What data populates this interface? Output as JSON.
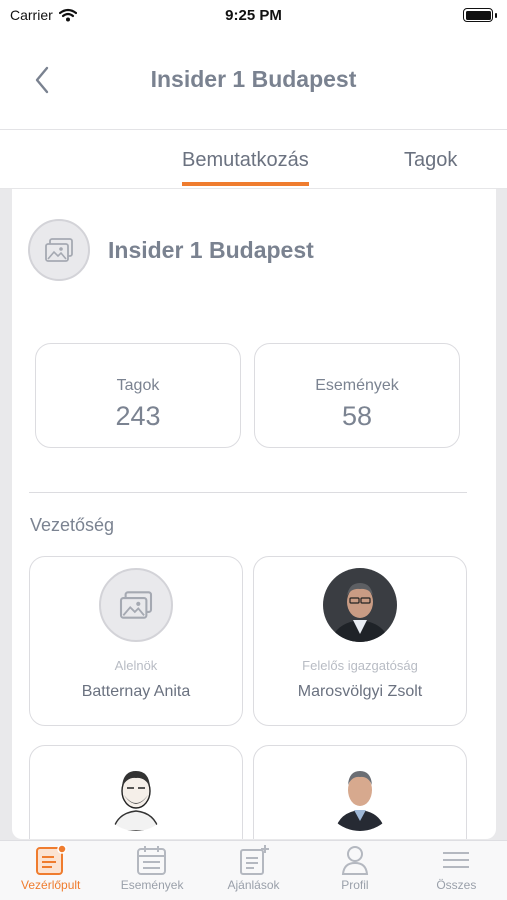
{
  "status_bar": {
    "carrier": "Carrier",
    "time": "9:25 PM"
  },
  "nav": {
    "title": "Insider 1 Budapest"
  },
  "tabs": [
    {
      "label": "Bemutatkozás",
      "active": true
    },
    {
      "label": "Tagok",
      "active": false
    }
  ],
  "group": {
    "name": "Insider 1 Budapest"
  },
  "stats": {
    "members": {
      "label": "Tagok",
      "value": "243"
    },
    "events": {
      "label": "Események",
      "value": "58"
    }
  },
  "leadership": {
    "title": "Vezetőség",
    "people": [
      {
        "role": "Alelnök",
        "name": "Batternay Anita"
      },
      {
        "role": "Felelős igazgatóság",
        "name": "Marosvölgyi Zsolt"
      },
      {
        "role": "",
        "name": ""
      },
      {
        "role": "",
        "name": ""
      }
    ]
  },
  "tab_bar": {
    "items": [
      {
        "label": "Vezérlőpult",
        "icon": "dashboard-icon",
        "active": true
      },
      {
        "label": "Események",
        "icon": "calendar-icon",
        "active": false
      },
      {
        "label": "Ajánlások",
        "icon": "recommendations-icon",
        "active": false
      },
      {
        "label": "Profil",
        "icon": "profile-icon",
        "active": false
      },
      {
        "label": "Összes",
        "icon": "menu-icon",
        "active": false
      }
    ]
  },
  "colors": {
    "accent": "#ef7c2e",
    "text": "#7a8290",
    "muted": "#b8bcc4"
  }
}
